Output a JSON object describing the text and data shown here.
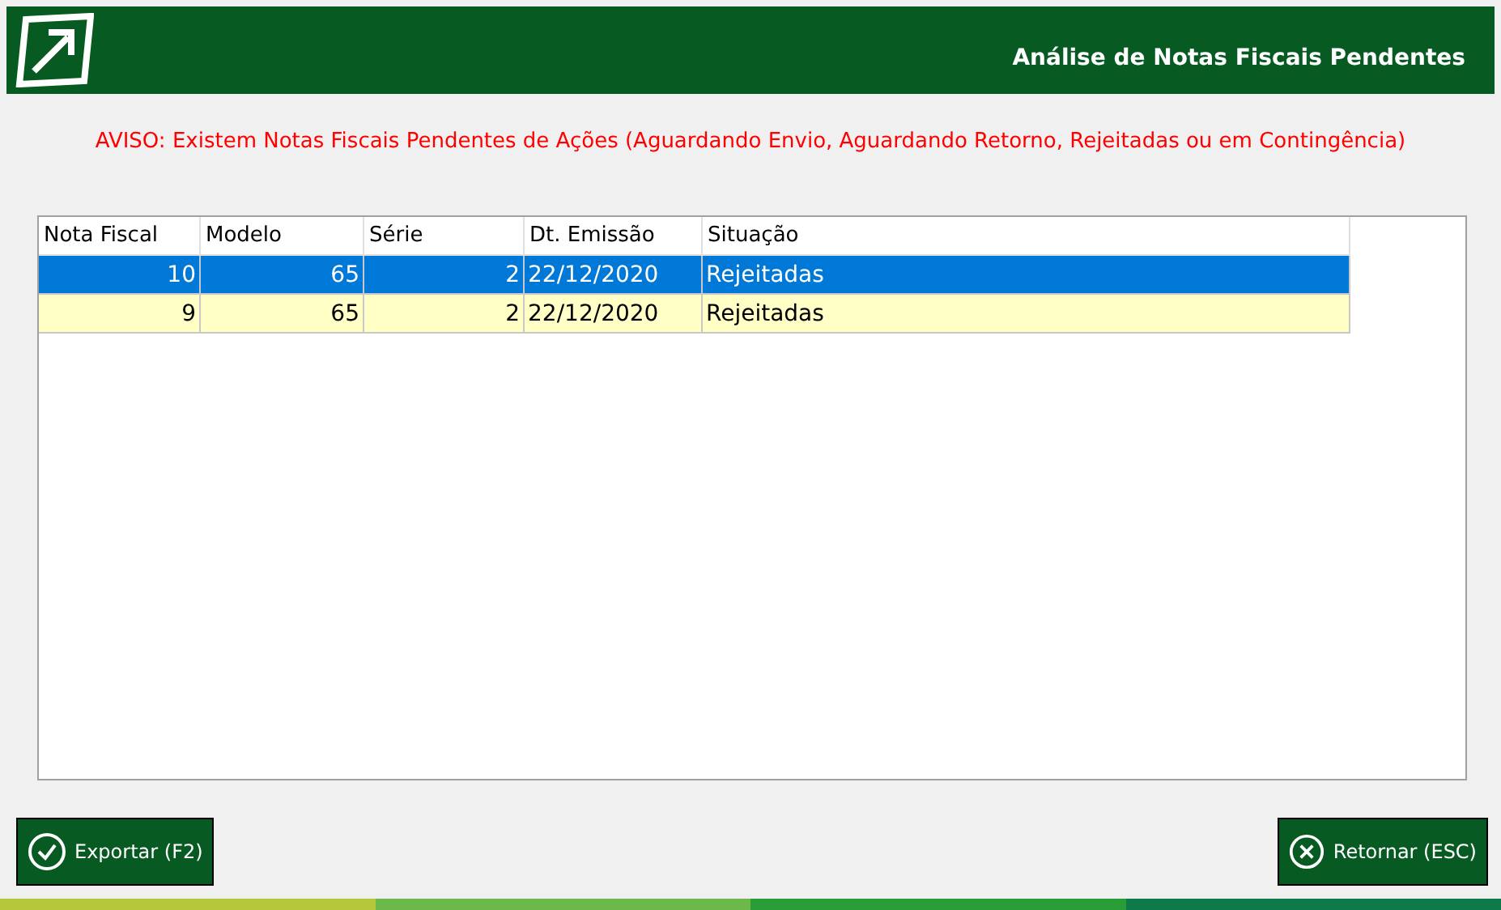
{
  "header": {
    "title": "Análise de Notas Fiscais Pendentes"
  },
  "warning": "AVISO: Existem Notas Fiscais Pendentes de Ações (Aguardando Envio, Aguardando Retorno, Rejeitadas ou em Contingência)",
  "table": {
    "columns": [
      "Nota Fiscal",
      "Modelo",
      "Série",
      "Dt. Emissão",
      "Situação"
    ],
    "rows": [
      {
        "cells": [
          "10",
          "65",
          "2",
          "22/12/2020",
          "Rejeitadas"
        ],
        "selected": true
      },
      {
        "cells": [
          "9",
          "65",
          "2",
          "22/12/2020",
          "Rejeitadas"
        ],
        "selected": false
      }
    ]
  },
  "buttons": [
    {
      "kind": "confirm",
      "label": "Exportar (F2)"
    },
    {
      "kind": "cancel",
      "label": "Retornar (ESC)"
    }
  ]
}
